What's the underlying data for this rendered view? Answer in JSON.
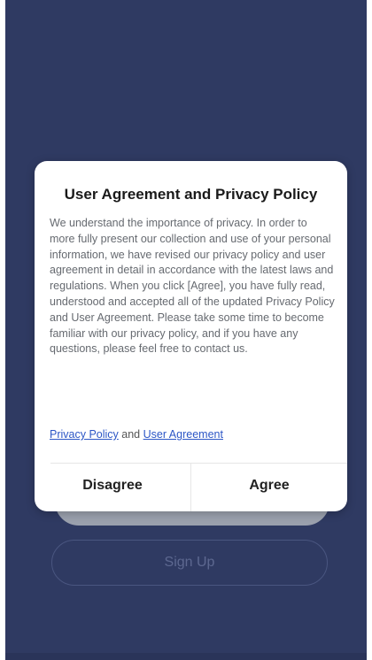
{
  "dialog": {
    "title": "User Agreement and Privacy Policy",
    "body": "We understand the importance of privacy. In order to more fully present our collection and use of your personal information, we have revised our privacy policy and user agreement in detail in accordance with the latest laws and regulations. When you click [Agree], you have fully read, understood and accepted all of the updated Privacy Policy and User Agreement. Please take some time to become familiar with our privacy policy, and if you have any questions, please feel free to contact us.",
    "privacy_link": "Privacy Policy",
    "links_joiner": "and",
    "agreement_link": "User Agreement",
    "disagree_label": "Disagree",
    "agree_label": "Agree"
  },
  "background": {
    "signup_label": "Sign Up",
    "login_label": ""
  },
  "colors": {
    "screen_background": "#2f3a62",
    "link": "#2c56c6",
    "dialog_background": "#ffffff"
  }
}
